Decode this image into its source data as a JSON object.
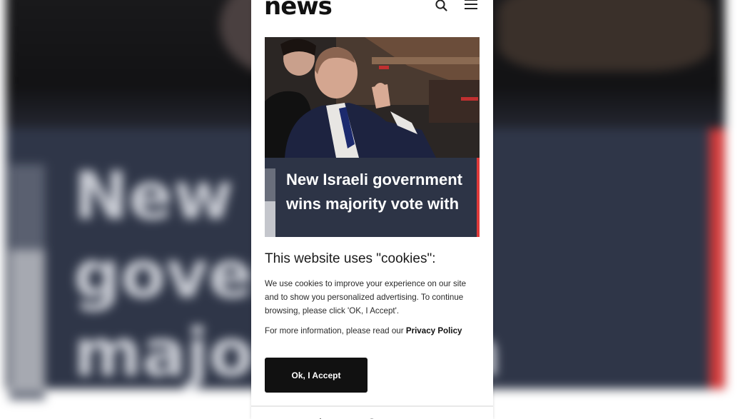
{
  "site": {
    "logo_text": "news"
  },
  "header": {
    "search_icon": "search-icon",
    "menu_icon": "hamburger-menu-icon"
  },
  "article": {
    "image_alt": "news photo",
    "headline": "New Israeli government wins majority vote with"
  },
  "background": {
    "title_text": "New Isr\ngovern    s\nmajorit     h"
  },
  "cookie_dialog": {
    "title": "This website uses \"cookies\":",
    "body": "We use cookies to improve your experience on our site and to show you personalized advertising. To continue browsing, please click 'OK, I Accept'.",
    "more_info_prefix": "For more information, please read our ",
    "privacy_link": "Privacy Policy",
    "accept_button": "Ok, I Accept"
  },
  "colors": {
    "panel": "#2d3446",
    "accent_red": "#e03a3a",
    "button": "#111111"
  }
}
